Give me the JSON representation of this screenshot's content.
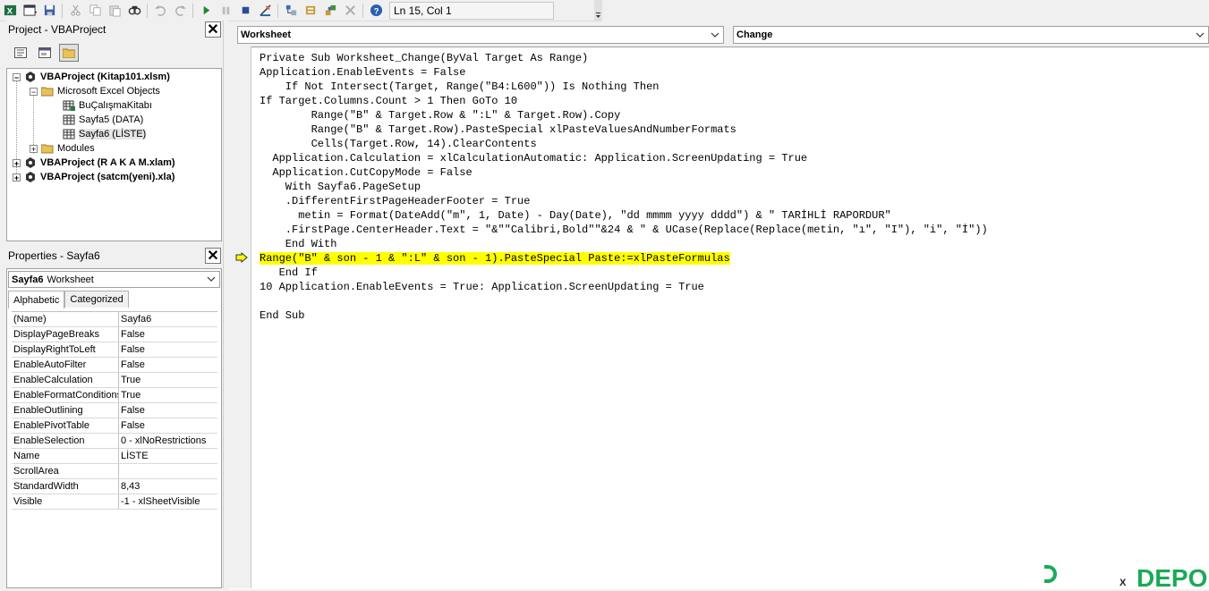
{
  "toolbar": {
    "status": "Ln 15, Col 1",
    "icons": [
      "excel-icon",
      "insert-userform-icon",
      "save-icon",
      "cut-icon",
      "copy-icon",
      "paste-icon",
      "find-icon",
      "undo-icon",
      "redo-icon",
      "run-icon",
      "break-icon",
      "reset-icon",
      "design-mode-icon",
      "project-explorer-icon",
      "properties-icon",
      "object-browser-icon",
      "toolbox-icon",
      "help-icon"
    ]
  },
  "project_panel": {
    "title": "Project - VBAProject",
    "tree": [
      {
        "label": "VBAProject (Kitap101.xlsm)",
        "bold": true
      },
      {
        "label": "Microsoft Excel Objects",
        "bold": false
      },
      {
        "label": "BuÇalışmaKitabı",
        "bold": false
      },
      {
        "label": "Sayfa5 (DATA)",
        "bold": false
      },
      {
        "label": "Sayfa6 (LİSTE)",
        "bold": false
      },
      {
        "label": "Modules",
        "bold": false
      },
      {
        "label": "VBAProject (R A K A M.xlam)",
        "bold": true
      },
      {
        "label": "VBAProject (satcm(yeni).xla)",
        "bold": true
      }
    ]
  },
  "properties_panel": {
    "title": "Properties - Sayfa6",
    "object_name": "Sayfa6",
    "object_type": "Worksheet",
    "tabs": [
      "Alphabetic",
      "Categorized"
    ],
    "rows": [
      [
        "(Name)",
        "Sayfa6"
      ],
      [
        "DisplayPageBreaks",
        "False"
      ],
      [
        "DisplayRightToLeft",
        "False"
      ],
      [
        "EnableAutoFilter",
        "False"
      ],
      [
        "EnableCalculation",
        "True"
      ],
      [
        "EnableFormatConditions",
        "True"
      ],
      [
        "EnableOutlining",
        "False"
      ],
      [
        "EnablePivotTable",
        "False"
      ],
      [
        "EnableSelection",
        "0 - xlNoRestrictions"
      ],
      [
        "Name",
        "LİSTE"
      ],
      [
        "ScrollArea",
        ""
      ],
      [
        "StandardWidth",
        "8,43"
      ],
      [
        "Visible",
        "-1 - xlSheetVisible"
      ]
    ]
  },
  "code_window": {
    "object_combo": "Worksheet",
    "procedure_combo": "Change",
    "highlight_index": 14,
    "lines": [
      "Private Sub Worksheet_Change(ByVal Target As Range)",
      "Application.EnableEvents = False",
      "    If Not Intersect(Target, Range(\"B4:L600\")) Is Nothing Then",
      "If Target.Columns.Count > 1 Then GoTo 10",
      "        Range(\"B\" & Target.Row & \":L\" & Target.Row).Copy",
      "        Range(\"B\" & Target.Row).PasteSpecial xlPasteValuesAndNumberFormats",
      "        Cells(Target.Row, 14).ClearContents",
      "  Application.Calculation = xlCalculationAutomatic: Application.ScreenUpdating = True",
      "  Application.CutCopyMode = False",
      "    With Sayfa6.PageSetup",
      "    .DifferentFirstPageHeaderFooter = True",
      "      metin = Format(DateAdd(\"m\", 1, Date) - Day(Date), \"dd mmmm yyyy dddd\") & \" TARİHLİ RAPORDUR\"",
      "    .FirstPage.CenterHeader.Text = \"&\"\"Calibri,Bold\"\"&24 & \" & UCase(Replace(Replace(metin, \"ı\", \"I\"), \"i\", \"İ\"))",
      "    End With",
      "Range(\"B\" & son - 1 & \":L\" & son - 1).PasteSpecial Paste:=xlPasteFormulas",
      "   End If",
      "10 Application.EnableEvents = True: Application.ScreenUpdating = True",
      "",
      "End Sub"
    ]
  },
  "watermark": {
    "text": "DEPO",
    "brand_color": "#1aaa55"
  }
}
